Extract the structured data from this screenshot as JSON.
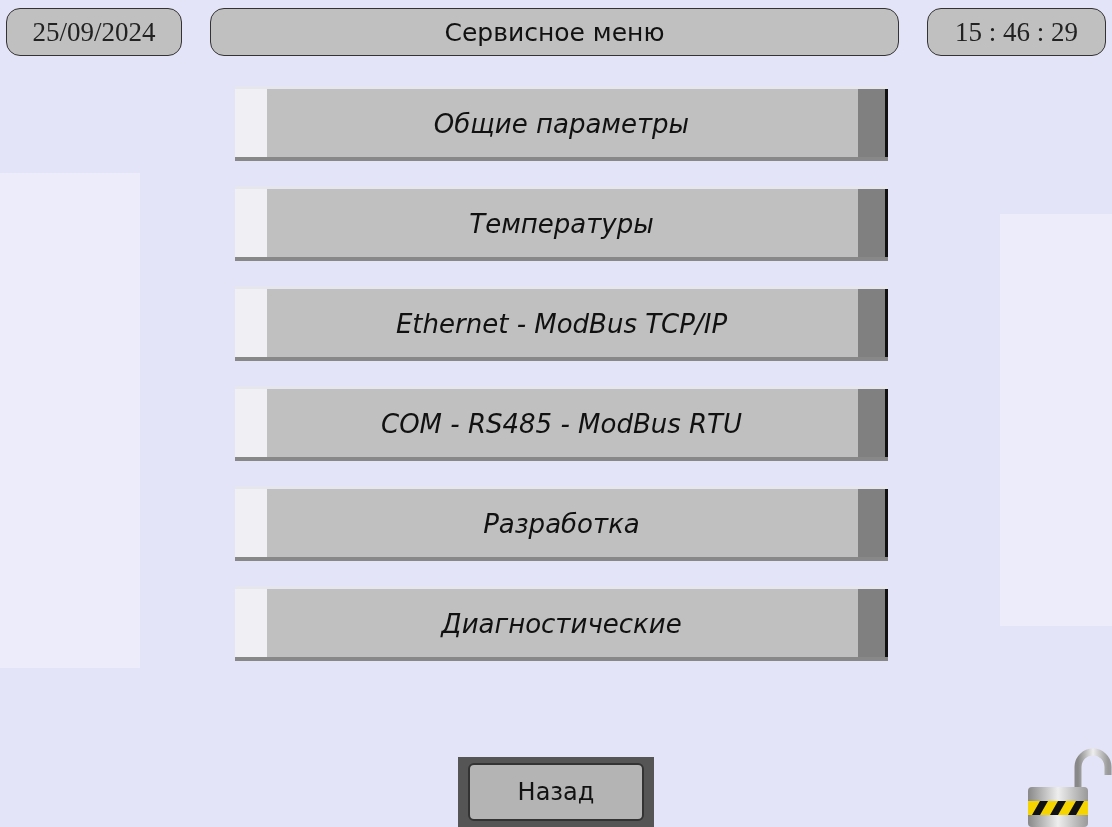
{
  "header": {
    "date": "25/09/2024",
    "title": "Сервисное меню",
    "time": "15 : 46 : 29"
  },
  "menu": [
    {
      "label": "Общие параметры"
    },
    {
      "label": "Температуры"
    },
    {
      "label": "Ethernet - ModBus TCP/IP"
    },
    {
      "label": "COM - RS485 - ModBus RTU"
    },
    {
      "label": "Разработка"
    },
    {
      "label": "Диагностические"
    }
  ],
  "back_button": "Назад",
  "lock": {
    "locked": false
  }
}
